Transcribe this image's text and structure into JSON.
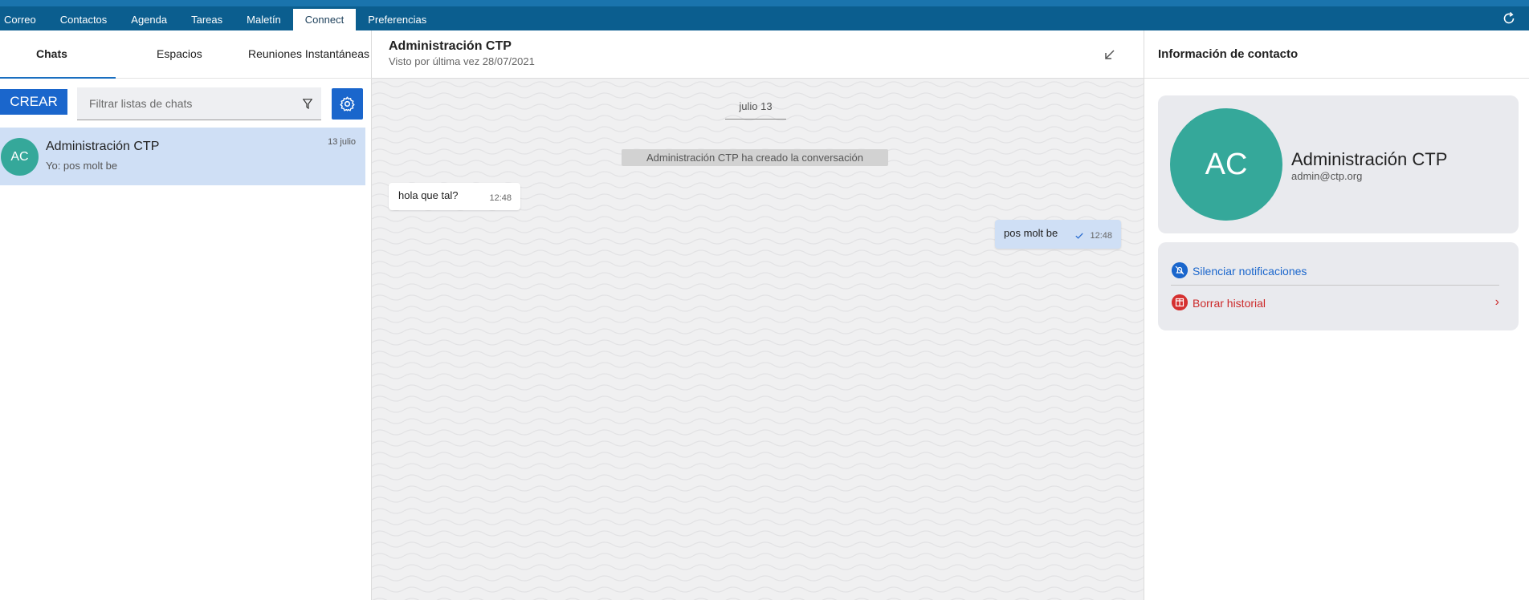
{
  "nav": {
    "tabs": [
      {
        "label": "Correo"
      },
      {
        "label": "Contactos"
      },
      {
        "label": "Agenda"
      },
      {
        "label": "Tareas"
      },
      {
        "label": "Maletín"
      },
      {
        "label": "Connect"
      },
      {
        "label": "Preferencias"
      }
    ],
    "active": "Connect",
    "refresh_icon": "refresh-icon"
  },
  "sidebar": {
    "tabs": [
      {
        "label": "Chats"
      },
      {
        "label": "Espacios"
      },
      {
        "label": "Reuniones Instantáneas"
      }
    ],
    "active_tab": "Chats",
    "create_label": "CREAR",
    "filter_placeholder": "Filtrar listas de chats",
    "filter_icon": "filter-icon",
    "settings_icon": "gear-icon",
    "chats": [
      {
        "initials": "AC",
        "name": "Administración CTP",
        "last_message": "Yo: pos molt be",
        "date": "13 julio"
      }
    ]
  },
  "conversation": {
    "title": "Administración CTP",
    "subtitle": "Visto por última vez 28/07/2021",
    "date_separator": "julio 13",
    "system_message": "Administración CTP ha creado la conversación",
    "messages": [
      {
        "direction": "in",
        "text": "hola que tal?",
        "time": "12:48"
      },
      {
        "direction": "out",
        "text": "pos molt be",
        "time": "12:48"
      }
    ]
  },
  "contact": {
    "header": "Información de contacto",
    "initials": "AC",
    "name": "Administración CTP",
    "email": "admin@ctp.org",
    "actions": [
      {
        "label": "Silenciar notificaciones",
        "icon": "bell-off-icon"
      },
      {
        "label": "Borrar historial",
        "icon": "trash-icon"
      }
    ]
  },
  "colors": {
    "nav_bg": "#0b5e8f",
    "accent": "#1a66cc",
    "avatar": "#35a89a",
    "selected_chat": "#cfdff5",
    "danger": "#cc2a2a"
  }
}
